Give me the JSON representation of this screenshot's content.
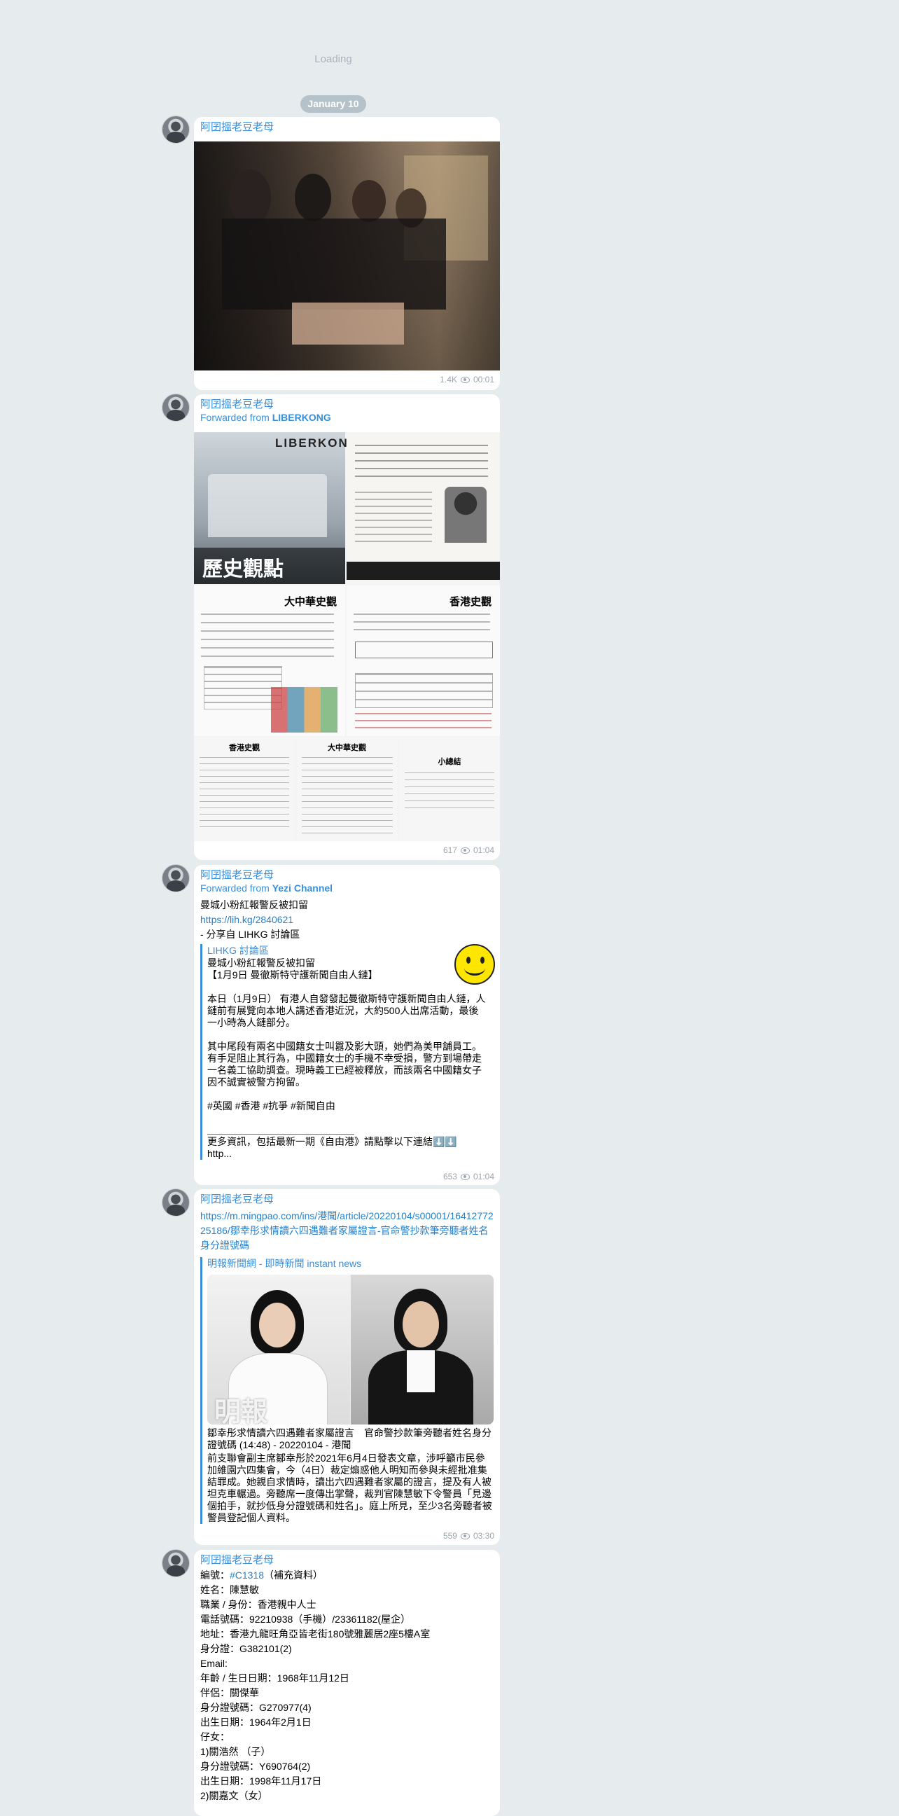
{
  "loading": "Loading",
  "date": "January 10",
  "messages": [
    {
      "author": "阿囝搵老豆老母",
      "views": "1.4K",
      "time": "00:01"
    },
    {
      "author": "阿囝搵老豆老母",
      "forwarded_label": "Forwarded from ",
      "forwarded_from": "LIBERKONG",
      "views": "617",
      "time": "01:04",
      "image": {
        "logo": "LIBERKONG",
        "title": "歷史觀點",
        "panel1": "大中華史觀",
        "panel2": "香港史觀",
        "panel3": "香港史觀",
        "panel4": "大中華史觀",
        "panel5": "小總結"
      }
    },
    {
      "author": "阿囝搵老豆老母",
      "forwarded_label": "Forwarded from ",
      "forwarded_from": "Yezi Channel",
      "line1": "曼城小粉紅報警反被扣留",
      "link": "https://lih.kg/2840621",
      "line3": "- 分享自 LIHKG 討論區",
      "preview_site": "LIHKG 討論區",
      "preview_body": "曼城小粉紅報警反被扣留\n【1月9日 曼徹斯特守護新聞自由人鏈】\n\n本日（1月9日） 有港人自發發起曼徹斯特守護新聞自由人鏈，人鏈前有展覽向本地人講述香港近況，大約500人出席活動，最後一小時為人鏈部分。\n\n其中尾段有兩名中國籍女士叫囂及影大頭，她們為美甲舖員工。有手足阻止其行為，中國籍女士的手機不幸受損，警方到場帶走一名義工協助調查。現時義工已經被釋放，而該兩名中國籍女子因不誠實被警方拘留。\n\n#英國 #香港 #抗爭 #新聞自由\n\n＿＿＿＿＿＿＿＿＿＿＿＿＿＿＿\n更多資訊，包括最新一期《自由港》請點擊以下連結⬇️⬇️\nhttp...",
      "views": "653",
      "time": "01:04"
    },
    {
      "author": "阿囝搵老豆老母",
      "link": "https://m.mingpao.com/ins/港聞/article/20220104/s00001/1641277225186/鄒幸彤求情讀六四遇難者家屬證言-官命警抄款筆旁聽者姓名身分證號碼",
      "preview_site": "明報新聞網 - 即時新聞 instant news",
      "watermark": "明報",
      "preview_title": "鄒幸彤求情讀六四遇難者家屬證言　官命警抄款筆旁聽者姓名身分證號碼 (14:48) - 20220104 - 港聞",
      "preview_body": "前支聯會副主席鄒幸彤於2021年6月4日發表文章，涉呼籲市民參加維園六四集會，今（4日）裁定煽惑他人明知而參與未經批准集結罪成。她親自求情時，讀出六四遇難者家屬的證言，提及有人被坦克車輾過。旁聽席一度傳出掌聲，裁判官陳慧敏下令警員「見邊個拍手，就抄低身分證號碼和姓名」。庭上所見，至少3名旁聽者被警員登記個人資料。",
      "views": "559",
      "time": "03:30"
    },
    {
      "author": "阿囝搵老豆老母",
      "hashtag": "#C1318",
      "lines": [
        "（補充資料）",
        "姓名：陳慧敏",
        "職業 / 身份：香港親中人士",
        "電話號碼：92210938（手機）/23361182(屋企）",
        "地址：香港九龍旺角亞皆老街180號雅麗居2座5樓A室",
        "身分證：G382101(2)",
        "Email:",
        "年齡 / 生日日期：1968年11月12日",
        "伴侶：關傑華",
        "身分證號碼：G270977(4)",
        "出生日期：1964年2月1日",
        "仔女：",
        "1)關浩然 （子）",
        "身分證號碼：Y690764(2)",
        "出生日期：1998年11月17日",
        "2)關嘉文（女）"
      ]
    }
  ]
}
